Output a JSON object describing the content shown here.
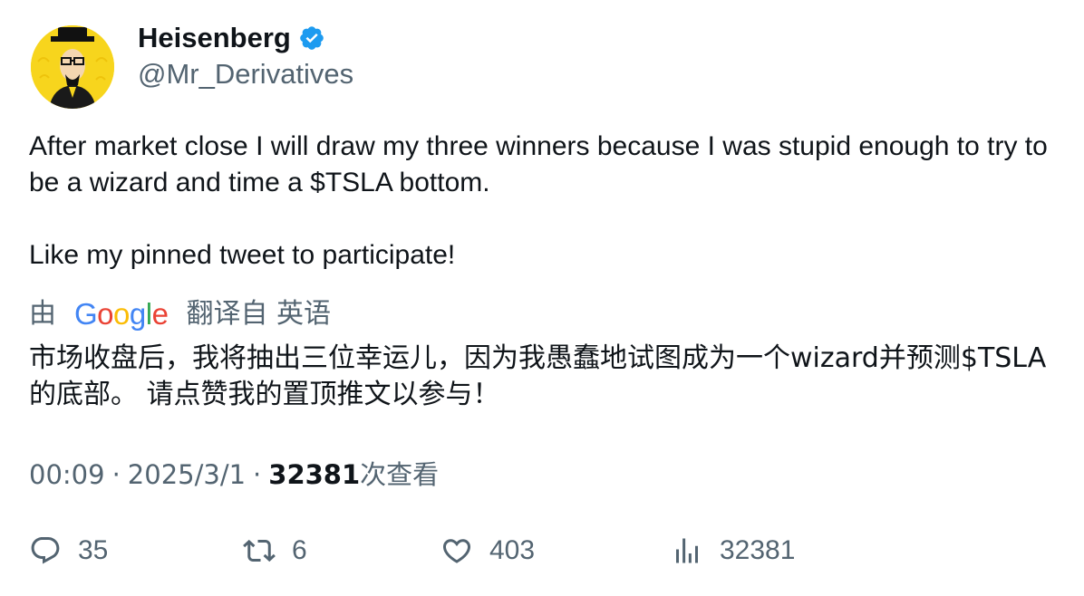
{
  "author": {
    "display_name": "Heisenberg",
    "handle": "@Mr_Derivatives",
    "verified_icon": "verified-badge-icon",
    "avatar_icon": "heisenberg-avatar"
  },
  "tweet": {
    "text": "After market close I will draw my three winners because I was stupid enough to try to be a wizard and time a $TSLA bottom.\n\nLike my pinned tweet to participate!"
  },
  "translation": {
    "prefix": "由",
    "provider": "Google",
    "suffix": "翻译自 英语",
    "text": "市场收盘后，我将抽出三位幸运儿，因为我愚蠢地试图成为一个wizard并预测$TSLA的底部。 请点赞我的置顶推文以参与！"
  },
  "meta": {
    "time": "00:09",
    "date": "2025/3/1",
    "views_count": "32381",
    "views_label": "次查看"
  },
  "actions": {
    "replies": "35",
    "retweets": "6",
    "likes": "403",
    "views": "32381"
  },
  "colors": {
    "verified": "#1d9bf0",
    "secondary_text": "#536471",
    "primary_text": "#0f1419",
    "avatar_bg": "#f7d51d"
  }
}
